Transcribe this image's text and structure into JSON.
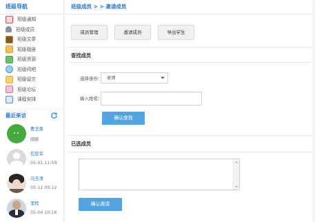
{
  "sidebar": {
    "title": "班级导航",
    "items": [
      {
        "label": "班级通知",
        "icon": "notice-icon",
        "color": "#d94c4c"
      },
      {
        "label": "班级成员",
        "icon": "members-icon",
        "color": "#6a6a8a"
      },
      {
        "label": "班级文章",
        "icon": "article-icon",
        "color": "#b68a2c"
      },
      {
        "label": "班级相册",
        "icon": "album-icon",
        "color": "#e0a030"
      },
      {
        "label": "班级资源",
        "icon": "resource-icon",
        "color": "#4ba34b"
      },
      {
        "label": "班级问吧",
        "icon": "question-icon",
        "color": "#4a9ad4"
      },
      {
        "label": "班级留言",
        "icon": "message-icon",
        "color": "#e3b040"
      },
      {
        "label": "班级论坛",
        "icon": "forum-icon",
        "color": "#d1779b"
      },
      {
        "label": "课程安排",
        "icon": "schedule-icon",
        "color": "#5b8ec8"
      }
    ],
    "recent_title": "最近来访",
    "visitors": [
      {
        "name": "曹芝勇",
        "time": "刚刚",
        "avatar": "green"
      },
      {
        "name": "包亚军",
        "time": "05-31 11:59",
        "avatar": "gray"
      },
      {
        "name": "马玉清",
        "time": "05-12 09:12",
        "avatar": "photo"
      },
      {
        "name": "李程",
        "time": "05-04 10:16",
        "avatar": "suit"
      }
    ]
  },
  "main": {
    "breadcrumb": "班级成员 > > 邀请成员",
    "buttons": [
      "成员管理",
      "邀请成员",
      "导出学生"
    ],
    "find_section": "查找成员",
    "identity_label": "选择身份：",
    "identity_value": "老师",
    "name_label": "输入姓名：",
    "name_value": "",
    "search_button": "确认查找",
    "selected_section": "已选成员",
    "invite_button": "确认邀请"
  },
  "colors": {
    "accent": "#52a4e0",
    "link": "#2d79c7"
  }
}
